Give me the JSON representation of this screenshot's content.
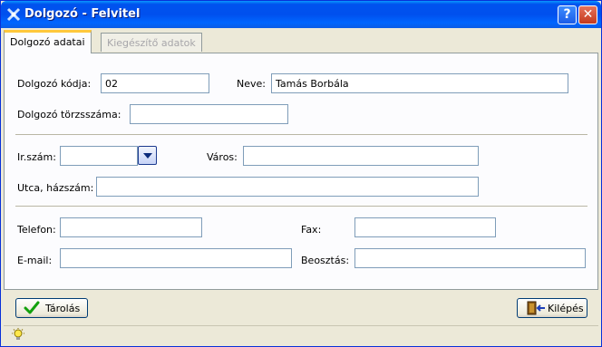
{
  "window": {
    "title": "Dolgozó - Felvitel",
    "help_label": "?",
    "close_label": "✕"
  },
  "tabs": [
    {
      "label": "Dolgozó adatai",
      "active": true
    },
    {
      "label": "Kiegészítő adatok",
      "active": false
    }
  ],
  "form": {
    "kod": {
      "label": "Dolgozó kódja:",
      "value": "02"
    },
    "nev": {
      "label": "Neve:",
      "value": "Tamás Borbála"
    },
    "torzsszam": {
      "label": "Dolgozó törzsszáma:",
      "value": ""
    },
    "irszam": {
      "label": "Ir.szám:",
      "value": ""
    },
    "varos": {
      "label": "Város:",
      "value": ""
    },
    "utca": {
      "label": "Utca, házszám:",
      "value": ""
    },
    "telefon": {
      "label": "Telefon:",
      "value": ""
    },
    "fax": {
      "label": "Fax:",
      "value": ""
    },
    "email": {
      "label": "E-mail:",
      "value": ""
    },
    "beosztas": {
      "label": "Beosztás:",
      "value": ""
    }
  },
  "buttons": {
    "save": "Tárolás",
    "exit": "Kilépés"
  },
  "icons": {
    "app": "app-icon",
    "help": "help-icon",
    "close": "close-icon",
    "dropdown": "chevron-down-icon",
    "save": "checkmark-icon",
    "exit": "exit-door-icon",
    "status": "lightbulb-icon"
  },
  "colors": {
    "titlebar": "#0053ee",
    "tab_highlight": "#ffc83c",
    "field_border": "#7f9db9"
  }
}
